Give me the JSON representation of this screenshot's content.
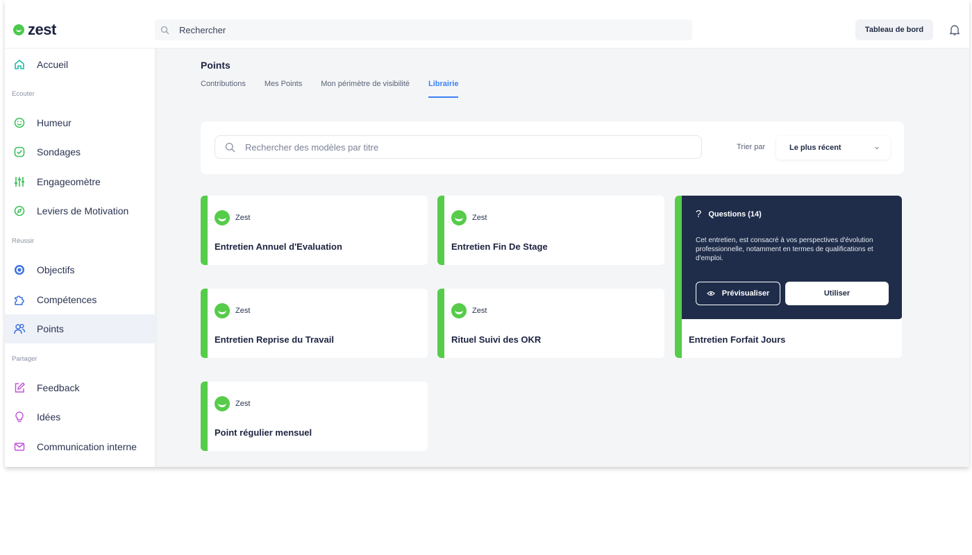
{
  "brand": {
    "name": "zest",
    "accent": "#56cc4a"
  },
  "topbar": {
    "search_placeholder": "Rechercher",
    "dashboard_label": "Tableau de bord"
  },
  "sidebar": {
    "home": {
      "label": "Accueil",
      "icon": "home-icon"
    },
    "sections": [
      {
        "title": "Ecouter",
        "items": [
          {
            "label": "Humeur",
            "icon": "smile-icon"
          },
          {
            "label": "Sondages",
            "icon": "check-square-icon"
          },
          {
            "label": "Engageomètre",
            "icon": "sliders-icon"
          },
          {
            "label": "Leviers de Motivation",
            "icon": "compass-icon"
          }
        ]
      },
      {
        "title": "Réussir",
        "items": [
          {
            "label": "Objectifs",
            "icon": "target-icon"
          },
          {
            "label": "Compétences",
            "icon": "puzzle-icon"
          },
          {
            "label": "Points",
            "icon": "users-icon",
            "active": true
          }
        ]
      },
      {
        "title": "Partager",
        "items": [
          {
            "label": "Feedback",
            "icon": "edit-icon"
          },
          {
            "label": "Idées",
            "icon": "lightbulb-icon"
          },
          {
            "label": "Communication interne",
            "icon": "mail-icon"
          }
        ]
      }
    ]
  },
  "main": {
    "title": "Points",
    "tabs": [
      {
        "label": "Contributions"
      },
      {
        "label": "Mes Points"
      },
      {
        "label": "Mon périmètre de visibilité"
      },
      {
        "label": "Librairie",
        "active": true
      }
    ],
    "filter": {
      "search_placeholder": "Rechercher des modèles par titre",
      "sort_label": "Trier par",
      "sort_value": "Le plus récent"
    },
    "cards": [
      {
        "brand": "Zest",
        "title": "Entretien Annuel d'Evaluation"
      },
      {
        "brand": "Zest",
        "title": "Entretien Fin De Stage"
      },
      {
        "brand": "Zest",
        "title": "Entretien Forfait Jours",
        "hover": {
          "questions": "Questions (14)",
          "description": "Cet entretien, est consacré à vos perspectives d'évolution professionnelle, notamment en termes de qualifications et d'emploi.",
          "preview_label": "Prévisualiser",
          "use_label": "Utiliser"
        }
      },
      {
        "brand": "Zest",
        "title": "Entretien Reprise du Travail"
      },
      {
        "brand": "Zest",
        "title": "Rituel Suivi des OKR"
      },
      {
        "brand": "Zest",
        "title": "Point régulier mensuel"
      }
    ]
  }
}
